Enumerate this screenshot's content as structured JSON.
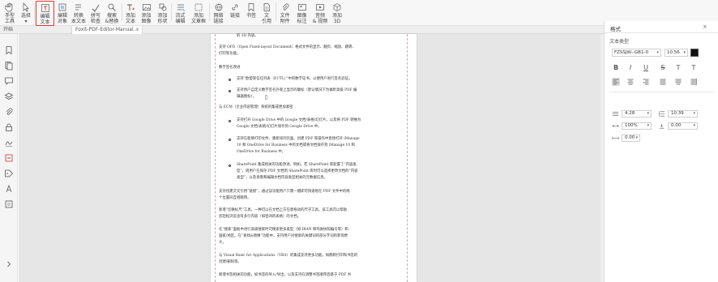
{
  "ribbon": {
    "hand_tool": [
      "手型",
      "工具"
    ],
    "select": [
      "选择"
    ],
    "edit_text": [
      "编辑",
      "文本"
    ],
    "edit_object": [
      "编辑",
      "对象"
    ],
    "convert_text": [
      "转换",
      "为",
      "本文本"
    ],
    "spell_check": [
      "拼写",
      "检查"
    ],
    "find_replace": [
      "搜索",
      "&替换"
    ],
    "add_text": [
      "添加",
      "文本"
    ],
    "add_image": [
      "添加",
      "图像"
    ],
    "add_shape": [
      "添加",
      "形状"
    ],
    "flow_edit": [
      "流式",
      "编辑"
    ],
    "add_article": [
      "添加",
      "文章框"
    ],
    "web_link": [
      "网络",
      "链接"
    ],
    "link": [
      "链接"
    ],
    "bookmark": [
      "书签"
    ],
    "file_ref": [
      "文",
      "引用"
    ],
    "add_attachment": [
      "文件",
      "附件"
    ],
    "image_annotation": [
      "图像",
      "标注"
    ],
    "audio_video": [
      "音频",
      "& 视频"
    ],
    "add_3d": [
      "添加",
      "3D"
    ]
  },
  "tabs": {
    "start": "开始",
    "doc": "Foxit-PDF-Editor-Manual..."
  },
  "document": {
    "lines": [
      "的 3D 内容。",
      "支持 OFD（Open Fixed-layout Document）格式文件的显示、翻页、缩放、跳转、",
      "打印等功能。",
      "数字签名改进",
      "支持“欧盟受信任列表（EUTL）”中的数字证书，以便用户进行签名验证。",
      "支持用户自定义数字签名外观上显示的徽标（默认情况下为福昕高级 PDF 编",
      "辑器图标）。",
      "与 ECM（企业内容管理）系统的集成更加紧密",
      "支持打开 Google Drive 中的 Google 文档/表格/幻灯片，以及将 PDF 转换为",
      "Google 文档/表格/幻灯片保存到 Google Drive 中。",
      "支持在能够打印文件、重新排列页面、创建 PDF 等操作中直接打开 iManage",
      "10 和 OneDrive for Business 中的文档或将文档保存到 iManage 10 和",
      "OneDrive for Business 中。",
      "SharePoint 集成相关的功能改进。例如，若 SharePoint 库配置了“内容类",
      "型”，则用户在保存 PDF 文档到 SharePoint 库时可以选择更改文档的“内容",
      "类型”，以及查看和编辑文档内容类型相关的元数据信息。",
      "支持创建交叉引用“链接”，通过该功能用户只需一键即可快速地在 PDF 文件中的两",
      "个位置间互相跳转。",
      "新增“切换标尺”工具，一种可以在文档上方任意拖动的尺子工具，该工具可以帮助",
      "您轻松浏览含有多行内容（如密闭的表格）的文档。",
      "在“搜索”面板中进行高级搜索时可搜索更多类型（如 IBAN 和驾驶执照编号等）和",
      "国家/地区。在“查找&替换”功能中，支持用户对搜索的关键词的部分字词的新询更",
      "大。",
      "与 Visual Basic for Applications（VBA）的集成支持更多功能。如静默打印和书签的",
      "创建/删除等。",
      "新增书签相关的功能，如书签的导入/导出，以及支持在调整书签顺序后基于 PDF 书"
    ]
  },
  "format_panel": {
    "title": "格式",
    "close": "×",
    "section": "文本类型",
    "font": "FZSSJW--GB1-0",
    "size": "10.56",
    "text_color": "#111111",
    "char_spacing": "4.28",
    "line_spacing": "10.39",
    "horiz_scale": "100%",
    "baseline": "0.00",
    "word_spacing": "0.00",
    "bold": "B",
    "italic": "I",
    "underline": "U",
    "strike": "S",
    "superscript": "T",
    "subscript": "T"
  },
  "colors": {
    "accent": "#e03a2f",
    "highlight_text": "#b54a3a"
  }
}
